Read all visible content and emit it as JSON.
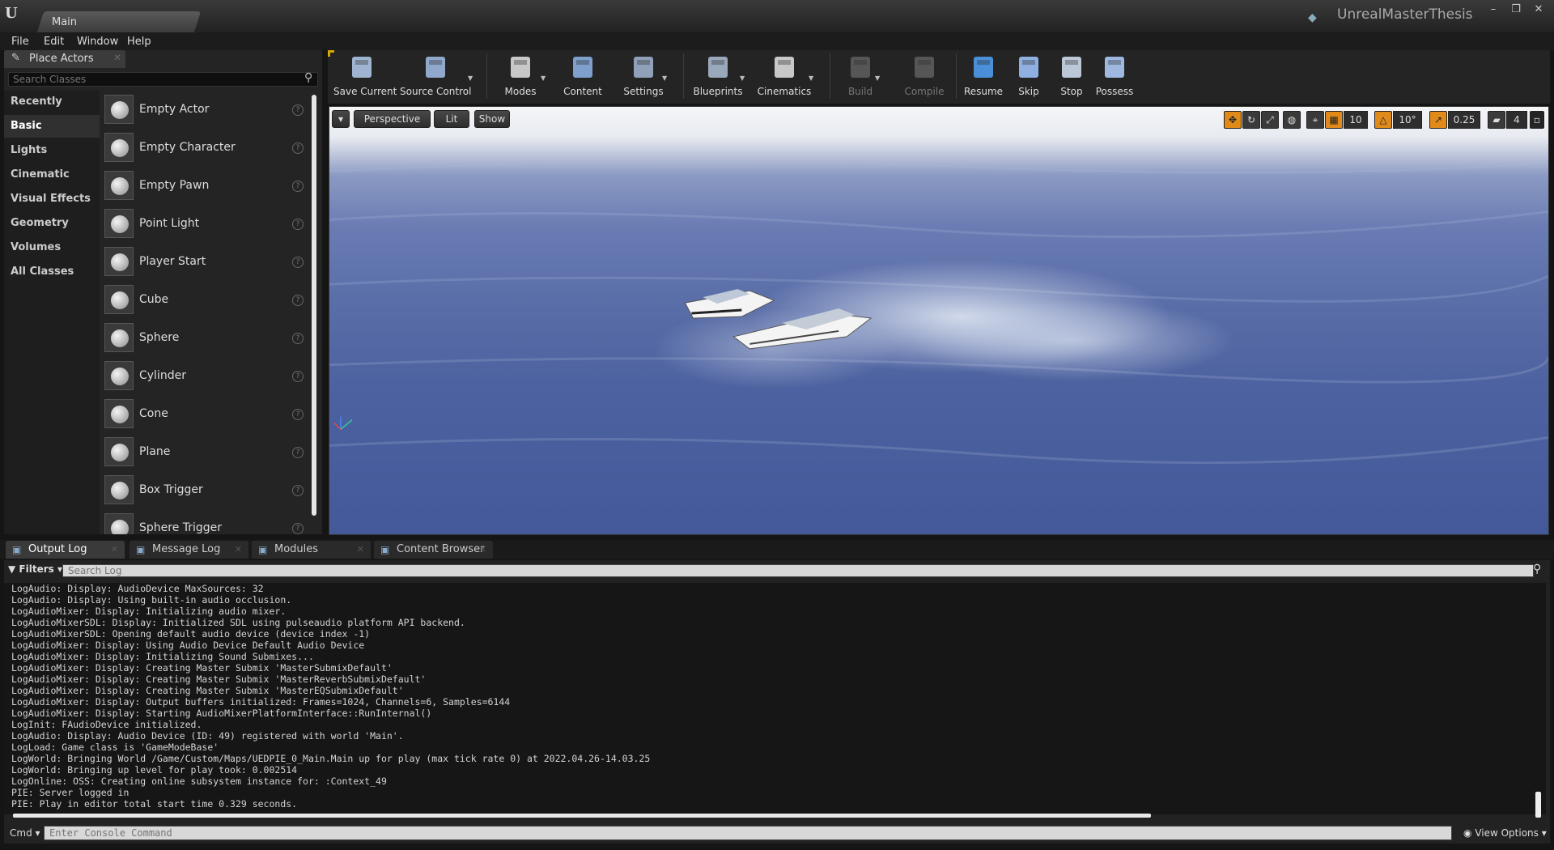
{
  "window": {
    "tab_title": "Main",
    "project_name": "UnrealMasterThesis",
    "controls": [
      "–",
      "❐",
      "✕"
    ]
  },
  "menu": [
    "File",
    "Edit",
    "Window",
    "Help"
  ],
  "place_actors": {
    "tab_label": "Place Actors",
    "search_placeholder": "Search Classes",
    "categories": [
      {
        "label": "Recently Placed",
        "active": false
      },
      {
        "label": "Basic",
        "active": true
      },
      {
        "label": "Lights",
        "active": false
      },
      {
        "label": "Cinematic",
        "active": false
      },
      {
        "label": "Visual Effects",
        "active": false
      },
      {
        "label": "Geometry",
        "active": false
      },
      {
        "label": "Volumes",
        "active": false
      },
      {
        "label": "All Classes",
        "active": false
      }
    ],
    "actors": [
      "Empty Actor",
      "Empty Character",
      "Empty Pawn",
      "Point Light",
      "Player Start",
      "Cube",
      "Sphere",
      "Cylinder",
      "Cone",
      "Plane",
      "Box Trigger",
      "Sphere Trigger"
    ]
  },
  "toolbar": {
    "buttons": [
      {
        "label": "Save Current",
        "icon": "save-icon",
        "enabled": true
      },
      {
        "label": "Source Control",
        "icon": "source-control-icon",
        "enabled": true
      },
      {
        "label": "Modes",
        "icon": "modes-icon",
        "enabled": true
      },
      {
        "label": "Content",
        "icon": "content-icon",
        "enabled": true
      },
      {
        "label": "Settings",
        "icon": "settings-icon",
        "enabled": true
      },
      {
        "label": "Blueprints",
        "icon": "blueprints-icon",
        "enabled": true
      },
      {
        "label": "Cinematics",
        "icon": "cinematics-icon",
        "enabled": true
      },
      {
        "label": "Build",
        "icon": "build-icon",
        "enabled": false
      },
      {
        "label": "Compile",
        "icon": "compile-icon",
        "enabled": false
      },
      {
        "label": "Resume",
        "icon": "resume-icon",
        "enabled": true
      },
      {
        "label": "Skip",
        "icon": "skip-icon",
        "enabled": true
      },
      {
        "label": "Stop",
        "icon": "stop-icon",
        "enabled": true
      },
      {
        "label": "Possess",
        "icon": "possess-icon",
        "enabled": true
      }
    ]
  },
  "viewport": {
    "dropdown": "▾",
    "view_mode": "Perspective",
    "lighting": "Lit",
    "show": "Show",
    "grid_snap": "10",
    "rotation_snap": "10°",
    "scale_snap": "0.25",
    "camera_speed": "4",
    "accent_color": "#e08a1a"
  },
  "bottom_tabs": [
    {
      "label": "Output Log",
      "icon": "output-log-icon",
      "active": true
    },
    {
      "label": "Message Log",
      "icon": "message-log-icon",
      "active": false
    },
    {
      "label": "Modules",
      "icon": "modules-icon",
      "active": false
    },
    {
      "label": "Content Browser",
      "icon": "content-browser-icon",
      "active": false
    }
  ],
  "output_log": {
    "filters_label": "Filters",
    "search_placeholder": "Search Log",
    "lines": [
      "LogAudio: Display: AudioDevice MaxSources: 32",
      "LogAudio: Display: Using built-in audio occlusion.",
      "LogAudioMixer: Display: Initializing audio mixer.",
      "LogAudioMixerSDL: Display: Initialized SDL using pulseaudio platform API backend.",
      "LogAudioMixerSDL: Opening default audio device (device index -1)",
      "LogAudioMixer: Display: Using Audio Device Default Audio Device",
      "LogAudioMixer: Display: Initializing Sound Submixes...",
      "LogAudioMixer: Display: Creating Master Submix 'MasterSubmixDefault'",
      "LogAudioMixer: Display: Creating Master Submix 'MasterReverbSubmixDefault'",
      "LogAudioMixer: Display: Creating Master Submix 'MasterEQSubmixDefault'",
      "LogAudioMixer: Display: Output buffers initialized: Frames=1024, Channels=6, Samples=6144",
      "LogAudioMixer: Display: Starting AudioMixerPlatformInterface::RunInternal()",
      "LogInit: FAudioDevice initialized.",
      "LogAudio: Display: Audio Device (ID: 49) registered with world 'Main'.",
      "LogLoad: Game class is 'GameModeBase'",
      "LogWorld: Bringing World /Game/Custom/Maps/UEDPIE_0_Main.Main up for play (max tick rate 0) at 2022.04.26-14.03.25",
      "LogWorld: Bringing up level for play took: 0.002514",
      "LogOnline: OSS: Creating online subsystem instance for: :Context_49",
      "PIE: Server logged in",
      "PIE: Play in editor total start time 0.329 seconds."
    ]
  },
  "console": {
    "cmd_label": "Cmd",
    "placeholder": "Enter Console Command",
    "view_options": "View Options"
  }
}
